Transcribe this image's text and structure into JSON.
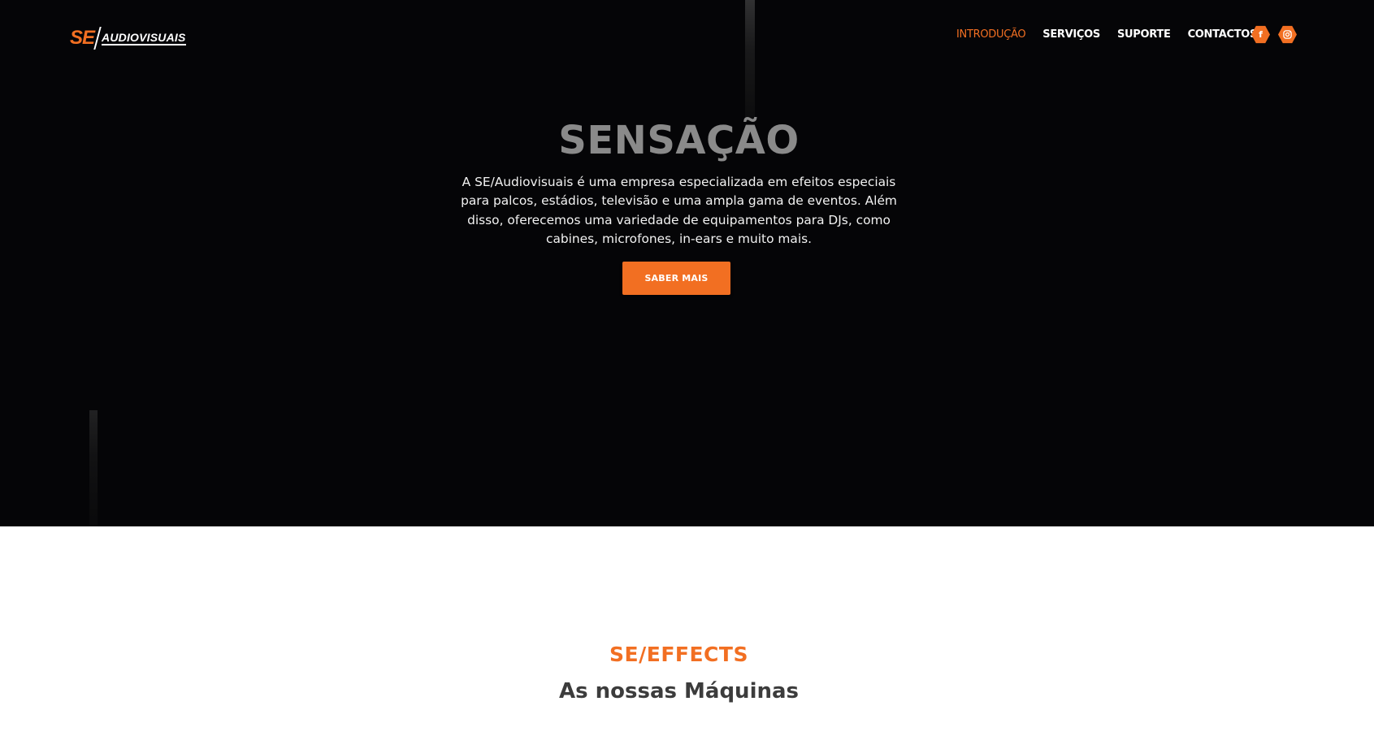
{
  "header": {
    "logo_se": "SE",
    "logo_audiovisuais": "AUDIOVISUAIS",
    "nav": [
      {
        "label": "INTRODUÇÃO",
        "active": true
      },
      {
        "label": "SERVIÇOS",
        "active": false
      },
      {
        "label": "SUPORTE",
        "active": false
      },
      {
        "label": "CONTACTOS",
        "active": false
      }
    ],
    "social": [
      {
        "icon": "facebook-icon",
        "glyph": "f"
      },
      {
        "icon": "instagram-icon",
        "glyph": ""
      }
    ]
  },
  "hero": {
    "title": "SENSAÇÃO",
    "description_lines": [
      "A SE/Audiovisuais é uma empresa especializada em efeitos especiais",
      "para palcos, estádios, televisão e uma ampla gama de eventos. Além",
      "disso, oferecemos uma variedade de equipamentos para DJs, como",
      "cabines, microfones, in-ears e muito mais."
    ],
    "cta_label": "SABER MAIS"
  },
  "section": {
    "subtitle": "SE/EFFECTS",
    "title": "As nossas Máquinas"
  },
  "colors": {
    "accent": "#f26f22",
    "hero_bg": "#050507",
    "heading_dark": "#3c3c3c"
  }
}
